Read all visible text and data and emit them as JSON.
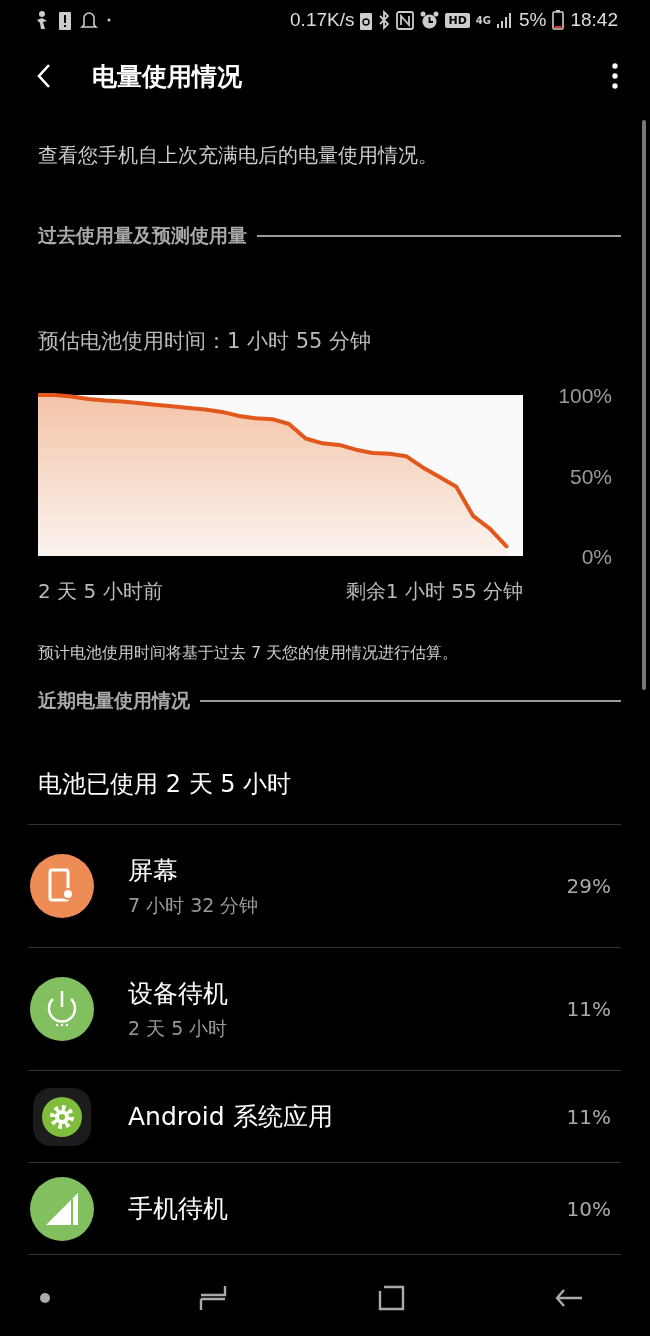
{
  "status_bar": {
    "net_speed": "0.17K/s",
    "hd_badge": "HD",
    "network_type": "4G",
    "battery": "5%",
    "time": "18:42"
  },
  "header": {
    "title": "电量使用情况"
  },
  "description": "查看您手机自上次充满电后的电量使用情况。",
  "history_section": {
    "title": "过去使用量及预测使用量",
    "estimate": "预估电池使用时间：1 小时 55 分钟",
    "chart_data": {
      "type": "area",
      "categories": [
        null,
        null,
        null,
        null,
        null,
        null,
        null,
        null,
        null,
        null,
        null,
        null,
        null,
        null,
        null,
        null,
        null,
        null,
        null,
        null,
        null,
        null,
        null,
        null,
        null,
        null,
        null,
        null,
        null
      ],
      "series": [
        {
          "color": "#e2571b",
          "values": [
            100,
            100,
            99,
            97.5,
            96.5,
            96,
            95,
            94,
            93,
            92,
            91,
            89.5,
            87,
            85.5,
            85,
            82,
            73,
            70,
            69,
            66,
            64,
            63.5,
            62,
            55,
            49,
            43,
            25,
            17,
            6
          ]
        }
      ],
      "ylim": [
        0,
        100
      ],
      "yticks": [
        {
          "value": 0,
          "label": "0%"
        },
        {
          "value": 50,
          "label": "50%"
        },
        {
          "value": 100,
          "label": "100%"
        }
      ]
    },
    "start_label": "2 天 5 小时前",
    "end_label": "剩余1 小时 55 分钟",
    "note": "预计电池使用时间将基于过去 7 天您的使用情况进行估算。"
  },
  "recent_section": {
    "title": "近期电量使用情况",
    "summary": "电池已使用 2 天 5 小时",
    "items": [
      {
        "kind": "screen",
        "name": "屏幕",
        "detail": "7 小时 32 分钟",
        "percent": "29%"
      },
      {
        "kind": "power",
        "name": "设备待机",
        "detail": "2 天 5 小时",
        "percent": "11%"
      },
      {
        "kind": "app",
        "name": "Android 系统应用",
        "percent": "11%"
      },
      {
        "kind": "signal",
        "name": "手机待机",
        "percent": "10%"
      }
    ]
  }
}
